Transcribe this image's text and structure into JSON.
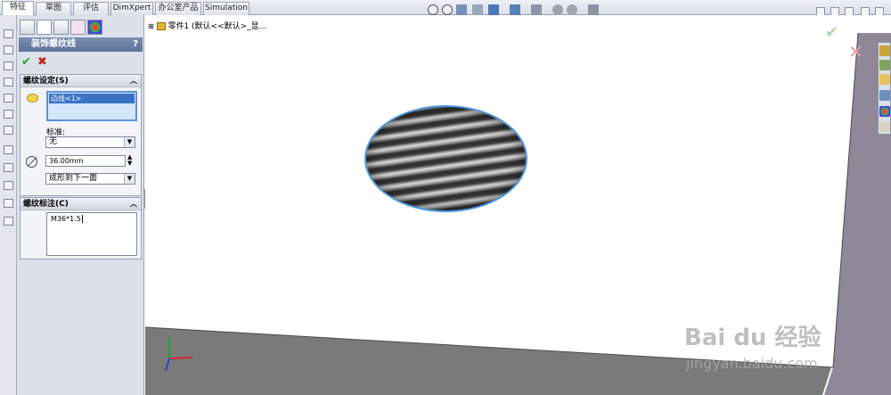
{
  "tabs": [
    {
      "label": "特征",
      "active": true
    },
    {
      "label": "草图",
      "active": false
    },
    {
      "label": "评估",
      "active": false
    },
    {
      "label": "DimXpert",
      "active": false
    },
    {
      "label": "办公室产品",
      "active": false
    },
    {
      "label": "Simulation",
      "active": false
    }
  ],
  "property_manager": {
    "title": "装饰螺纹线",
    "help": "?",
    "ok_symbol": "✔",
    "cancel_symbol": "✖",
    "thread_settings": {
      "header": "螺纹设定(S)",
      "edge_selection": "边线<1>",
      "standard_label": "标准:",
      "standard_value": "无",
      "diameter_value": "36.00mm",
      "end_condition_value": "成形到下一面"
    },
    "thread_callout": {
      "header": "螺纹标注(C)",
      "value": "M36*1.5"
    }
  },
  "tree": {
    "part_label": "零件1  (默认<<默认>_显..."
  },
  "watermark": {
    "brand": "Bai du 经验",
    "url": "jingyan.baidu.com"
  },
  "colors": {
    "panel_bg": "#dce1ea",
    "title_bar": "#6a7fa3",
    "selection_border": "#5b94d8",
    "ok_green": "#2a9a2a",
    "cancel_red": "#c42020"
  }
}
